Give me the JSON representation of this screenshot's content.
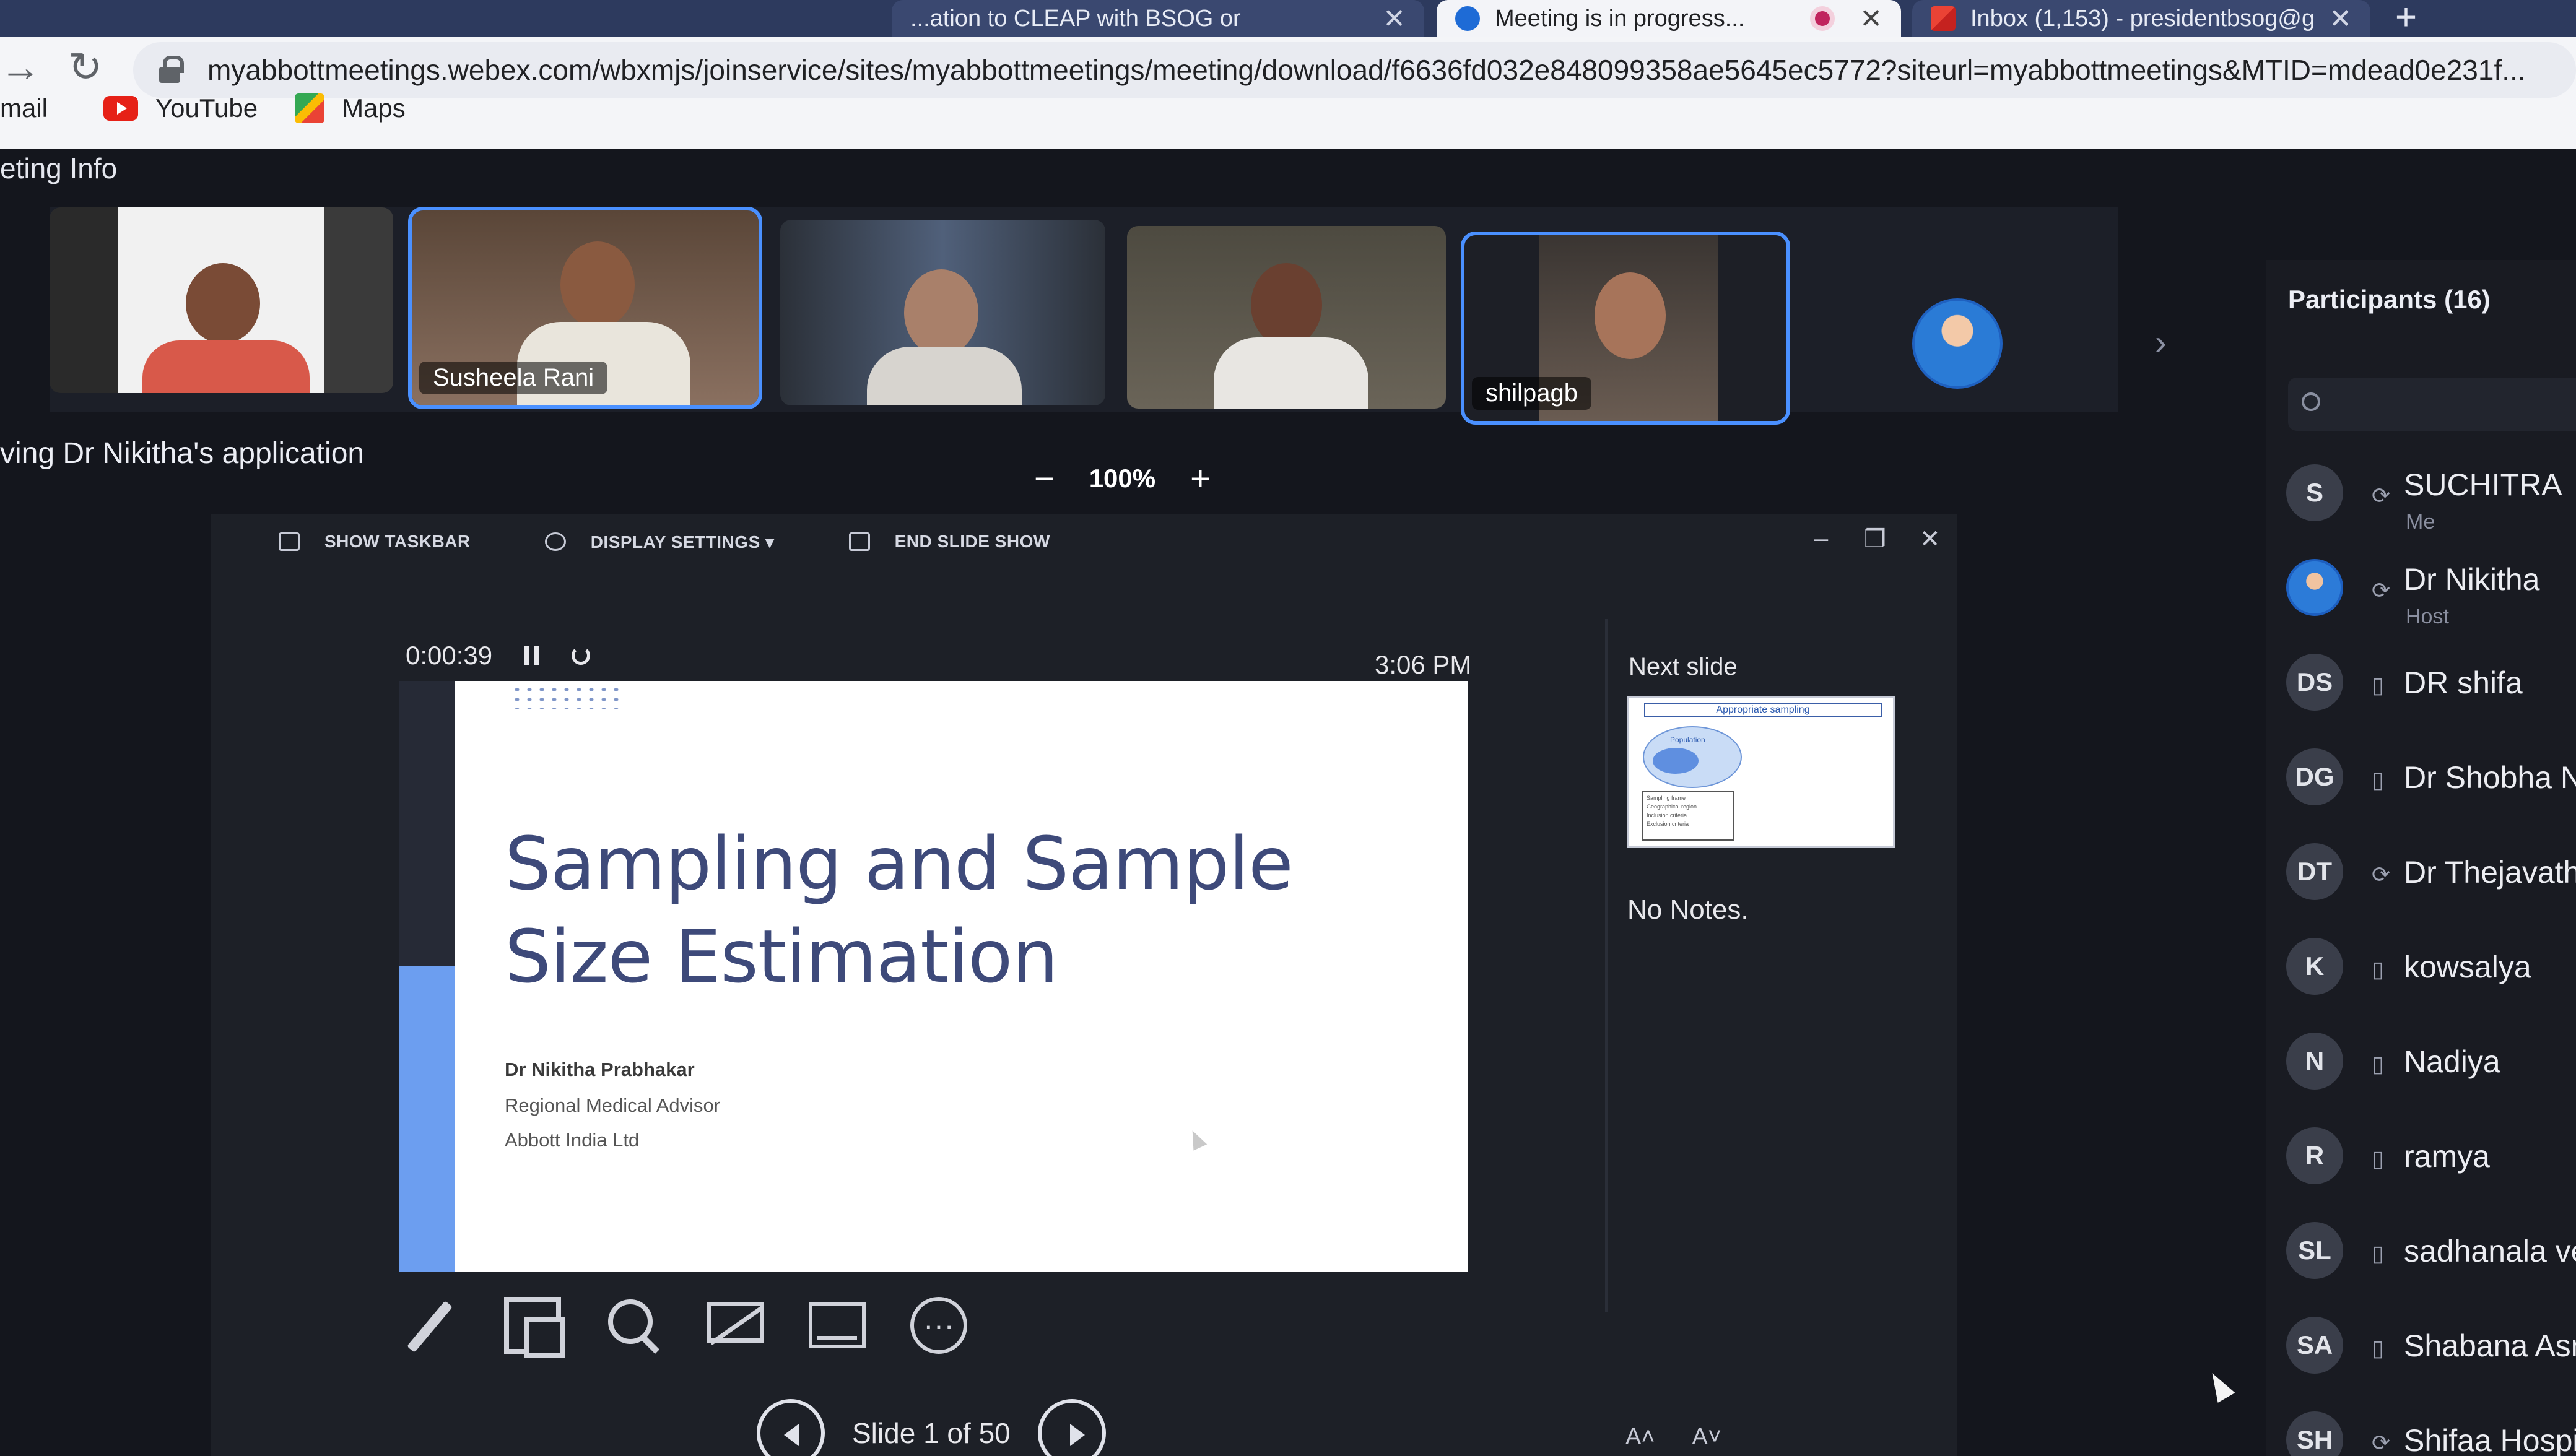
{
  "browser": {
    "tabs": [
      {
        "label": "...ation to CLEAP with BSOG or",
        "close": "✕"
      },
      {
        "label": "Meeting is in progress...",
        "close": "✕"
      },
      {
        "label": "Inbox (1,153) - presidentbsog@g",
        "close": "✕"
      }
    ],
    "new_tab": "+",
    "url": "myabbottmeetings.webex.com/wbxmjs/joinservice/sites/myabbottmeetings/meeting/download/f6636fd032e848099358ae5645ec5772?siteurl=myabbottmeetings&MTID=mdead0e231f...",
    "bookmarks": [
      {
        "label": "mail",
        "icon": "gmail-icon"
      },
      {
        "label": "YouTube",
        "icon": "youtube-icon"
      },
      {
        "label": "Maps",
        "icon": "maps-icon"
      }
    ],
    "accent": "#2d3a5e"
  },
  "meeting": {
    "info_label": "eting Info",
    "sharing_label": "ving Dr Nikitha's application",
    "zoom": {
      "minus": "−",
      "level": "100%",
      "plus": "+"
    },
    "videos": [
      {
        "name": ""
      },
      {
        "name": "Susheela Rani"
      },
      {
        "name": ""
      },
      {
        "name": ""
      },
      {
        "name": "shilpagb"
      }
    ],
    "strip_next": "›",
    "speaking_color": "#4a90ff"
  },
  "presenter": {
    "toolbar": {
      "show_taskbar": "SHOW TASKBAR",
      "display_settings": "DISPLAY SETTINGS ▾",
      "end_slide_show": "END SLIDE SHOW"
    },
    "window_controls": {
      "minimize": "–",
      "restore": "❐",
      "close": "✕"
    },
    "timer": "0:00:39",
    "clock": "3:06 PM",
    "slide": {
      "title_line1": "Sampling and Sample",
      "title_line2": "Size Estimation",
      "author": "Dr Nikitha Prabhakar",
      "role": "Regional Medical Advisor",
      "org": "Abbott India Ltd"
    },
    "slide_counter": "Slide 1 of 50",
    "next_slide_label": "Next slide",
    "next_slide": {
      "title": "Appropriate sampling",
      "population": "Population",
      "box_lines": [
        "Sampling frame",
        "Geographical region",
        "Inclusion criteria",
        "Exclusion criteria"
      ]
    },
    "notes": "No Notes.",
    "font_buttons": [
      "A˄",
      "A˅"
    ],
    "tools": [
      "pen-icon",
      "slides-grid-icon",
      "zoom-icon",
      "black-screen-icon",
      "subtitles-icon",
      "more-options-icon"
    ]
  },
  "participants": {
    "title": "Participants (16)",
    "list": [
      {
        "initials": "S",
        "name": "SUCHITRA",
        "sub": "Me",
        "status": "⟳"
      },
      {
        "initials": "",
        "name": "Dr Nikitha",
        "sub": "Host",
        "status": "⟳",
        "photo": true
      },
      {
        "initials": "DS",
        "name": "DR shifa",
        "sub": "",
        "status": "▯"
      },
      {
        "initials": "DG",
        "name": "Dr Shobha N",
        "sub": "",
        "status": "▯"
      },
      {
        "initials": "DT",
        "name": "Dr Thejavath",
        "sub": "",
        "status": "⟳"
      },
      {
        "initials": "K",
        "name": "kowsalya",
        "sub": "",
        "status": "▯"
      },
      {
        "initials": "N",
        "name": "Nadiya",
        "sub": "",
        "status": "▯"
      },
      {
        "initials": "R",
        "name": "ramya",
        "sub": "",
        "status": "▯"
      },
      {
        "initials": "SL",
        "name": "sadhanala ve",
        "sub": "",
        "status": "▯"
      },
      {
        "initials": "SA",
        "name": "Shabana Asm",
        "sub": "",
        "status": "▯"
      },
      {
        "initials": "SH",
        "name": "Shifaa Hospit",
        "sub": "",
        "status": "⟳"
      }
    ]
  }
}
